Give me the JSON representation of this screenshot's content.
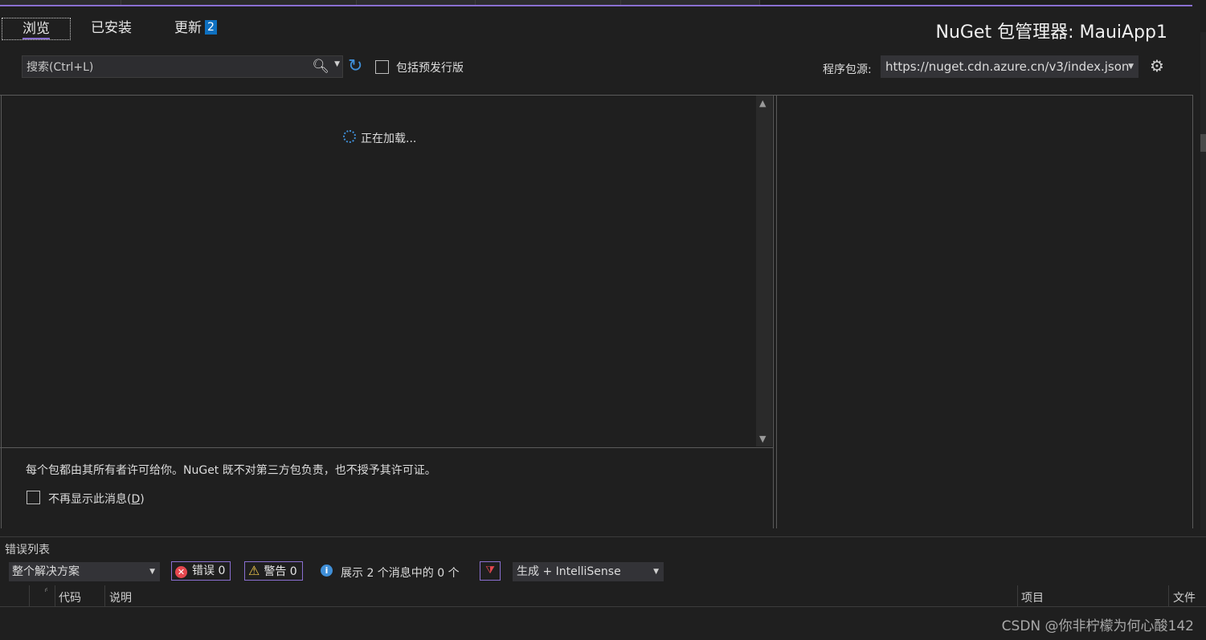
{
  "tabs": {
    "browse": "浏览",
    "installed": "已安装",
    "updates": "更新",
    "updates_count": "2"
  },
  "title": "NuGet 包管理器: MauiApp1",
  "search": {
    "placeholder": "搜索(Ctrl+L)"
  },
  "prerelease_label": "包括预发行版",
  "package_source": {
    "label": "程序包源:",
    "value": "https://nuget.cdn.azure.cn/v3/index.json"
  },
  "loading_text": "正在加载...",
  "license_notice": "每个包都由其所有者许可给你。NuGet 既不对第三方包负责，也不授予其许可证。",
  "dont_show": {
    "label_prefix": "不再显示此消息(",
    "label_key": "D",
    "label_suffix": ")"
  },
  "error_list": {
    "title": "错误列表",
    "scope": "整个解决方案",
    "errors_label": "错误 0",
    "warnings_label": "警告 0",
    "messages_label": "展示 2 个消息中的 0 个",
    "build_filter": "生成 + IntelliSense",
    "columns": {
      "code": "代码",
      "description": "说明",
      "project": "项目",
      "file": "文件"
    }
  },
  "watermark": "CSDN @你非柠檬为何心酸142",
  "icons": {
    "search": "search-icon",
    "refresh": "refresh-icon",
    "settings": "gear-icon",
    "error": "error-icon",
    "warning": "warning-icon",
    "info": "info-icon",
    "filter": "filter-icon"
  },
  "colors": {
    "accent": "#8a6fd1",
    "badge": "#0e70c0",
    "refresh": "#3f8fd8",
    "error": "#e5474e",
    "warning": "#f2c94c"
  }
}
